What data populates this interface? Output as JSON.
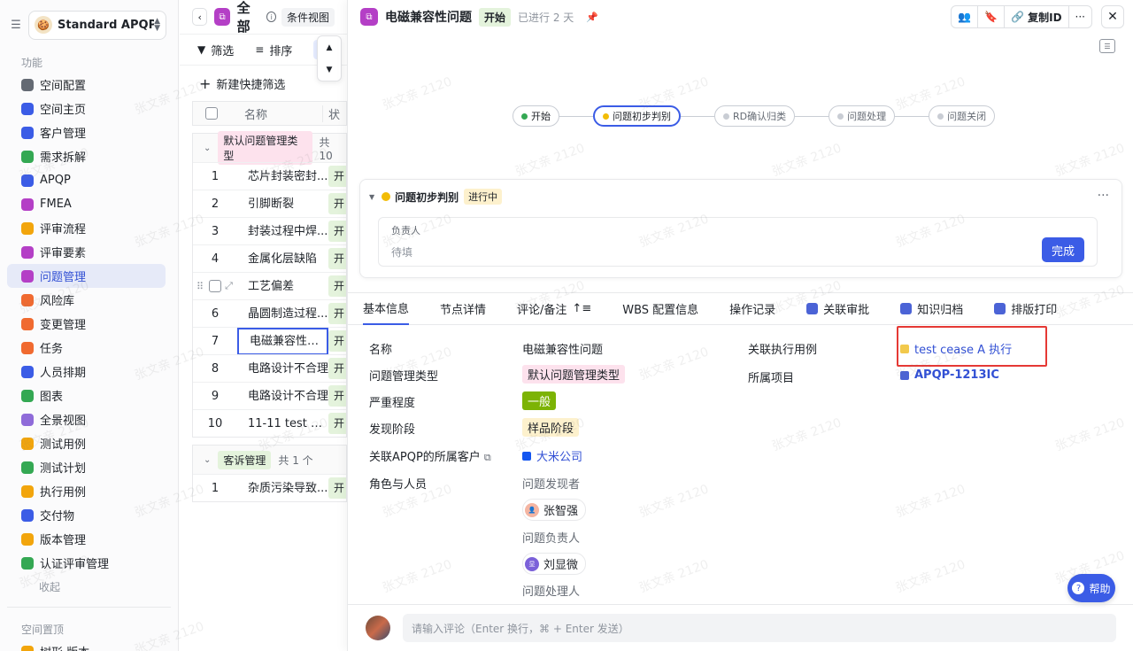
{
  "sidebar": {
    "space_name": "Standard APQP...",
    "section_functions": "功能",
    "items": [
      {
        "label": "空间配置",
        "color": "#646a73"
      },
      {
        "label": "空间主页",
        "color": "#3b5ce6"
      },
      {
        "label": "客户管理",
        "color": "#3b5ce6"
      },
      {
        "label": "需求拆解",
        "color": "#34a853"
      },
      {
        "label": "APQP",
        "color": "#3b5ce6"
      },
      {
        "label": "FMEA",
        "color": "#b43fc6"
      },
      {
        "label": "评审流程",
        "color": "#f2a50c"
      },
      {
        "label": "评审要素",
        "color": "#b43fc6"
      },
      {
        "label": "问题管理",
        "color": "#b43fc6"
      },
      {
        "label": "风险库",
        "color": "#f06a30"
      },
      {
        "label": "变更管理",
        "color": "#f06a30"
      },
      {
        "label": "任务",
        "color": "#f06a30"
      },
      {
        "label": "人员排期",
        "color": "#3b5ce6"
      },
      {
        "label": "图表",
        "color": "#34a853"
      },
      {
        "label": "全景视图",
        "color": "#8f6bd9"
      },
      {
        "label": "测试用例",
        "color": "#f2a50c"
      },
      {
        "label": "测试计划",
        "color": "#34a853"
      },
      {
        "label": "执行用例",
        "color": "#f2a50c"
      },
      {
        "label": "交付物",
        "color": "#3b5ce6"
      },
      {
        "label": "版本管理",
        "color": "#f2a50c"
      },
      {
        "label": "认证评审管理",
        "color": "#34a853"
      }
    ],
    "collapse_label": "收起",
    "section_pinned": "空间置顶",
    "pinned_item": "树形 版本"
  },
  "list": {
    "title": "全部",
    "view": "条件视图",
    "filter": "筛选",
    "sort": "排序",
    "new_quick_filter": "新建快捷筛选",
    "col_name": "名称",
    "col_status": "状",
    "groups": [
      {
        "name": "默认问题管理类型",
        "count": "共 10",
        "rows": [
          {
            "num": "1",
            "name": "芯片封装密封...",
            "status": "开"
          },
          {
            "num": "2",
            "name": "引脚断裂",
            "status": "开"
          },
          {
            "num": "3",
            "name": "封装过程中焊...",
            "status": "开"
          },
          {
            "num": "4",
            "name": "金属化层缺陷",
            "status": "开"
          },
          {
            "num": "5",
            "name": "工艺偏差",
            "status": "开"
          },
          {
            "num": "6",
            "name": "晶圆制造过程...",
            "status": "开"
          },
          {
            "num": "7",
            "name": "电磁兼容性问题",
            "status": "开"
          },
          {
            "num": "8",
            "name": "电路设计不合理",
            "status": "开"
          },
          {
            "num": "9",
            "name": "电路设计不合理",
            "status": "开"
          },
          {
            "num": "10",
            "name": "11-11 test cas...",
            "status": "开"
          }
        ]
      },
      {
        "name": "客诉管理",
        "count": "共 1 个",
        "rows": [
          {
            "num": "1",
            "name": "杂质污染导致...",
            "status": "开"
          }
        ]
      }
    ]
  },
  "detail": {
    "title": "电磁兼容性问题",
    "status": "开始",
    "days": "已进行 2 天",
    "copy_id": "复制ID",
    "flow": [
      {
        "label": "开始",
        "color": "#34a853"
      },
      {
        "label": "问题初步判别",
        "color": "#f2bc06"
      },
      {
        "label": "RD确认归类",
        "color": "#c9cdd4"
      },
      {
        "label": "问题处理",
        "color": "#c9cdd4"
      },
      {
        "label": "问题关闭",
        "color": "#c9cdd4"
      }
    ],
    "stage": {
      "name": "问题初步判别",
      "state": "进行中",
      "owner_label": "负责人",
      "owner_value": "待填",
      "done": "完成"
    },
    "tabs": [
      "基本信息",
      "节点详情",
      "评论/备注",
      "WBS 配置信息",
      "操作记录",
      "关联审批",
      "知识归档",
      "排版打印"
    ],
    "fields": {
      "name_label": "名称",
      "name_value": "电磁兼容性问题",
      "type_label": "问题管理类型",
      "type_value": "默认问题管理类型",
      "severity_label": "严重程度",
      "severity_value": "一般",
      "phase_label": "发现阶段",
      "phase_value": "样品阶段",
      "customer_label": "关联APQP的所属客户",
      "customer_value": "大米公司",
      "roles_label": "角色与人员",
      "finder_label": "问题发现者",
      "finder_value": "张智强",
      "owner_label": "问题负责人",
      "owner_value": "刘显微",
      "handler_label": "问题处理人",
      "exec_label": "关联执行用例",
      "exec_value": "test cease A 执行",
      "project_label": "所属项目",
      "project_value": "APQP-1213IC"
    },
    "help": "帮助",
    "comment_placeholder": "请输入评论（Enter 换行，⌘ + Enter 发送）"
  },
  "watermark": "张文亲 2120"
}
